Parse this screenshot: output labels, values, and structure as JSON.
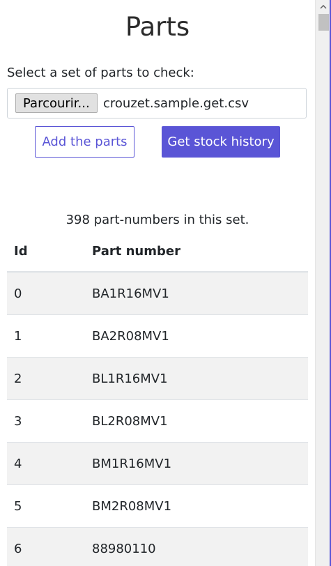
{
  "page": {
    "title": "Parts",
    "select_label": "Select a set of parts to check:",
    "file_button_label": "Parcourir...",
    "file_name": "crouzet.sample.get.csv",
    "add_button_label": "Add the parts",
    "history_button_label": "Get stock history",
    "count_text": "398 part-numbers in this set."
  },
  "table": {
    "headers": {
      "id": "Id",
      "part_number": "Part number"
    },
    "rows": [
      {
        "id": "0",
        "part_number": "BA1R16MV1"
      },
      {
        "id": "1",
        "part_number": "BA2R08MV1"
      },
      {
        "id": "2",
        "part_number": "BL1R16MV1"
      },
      {
        "id": "3",
        "part_number": "BL2R08MV1"
      },
      {
        "id": "4",
        "part_number": "BM1R16MV1"
      },
      {
        "id": "5",
        "part_number": "BM2R08MV1"
      },
      {
        "id": "6",
        "part_number": "88980110"
      }
    ]
  },
  "icons": {
    "scroll_up": "chevron-up-icon"
  },
  "colors": {
    "accent": "#5a55d6",
    "stripe": "#f2f2f2"
  }
}
